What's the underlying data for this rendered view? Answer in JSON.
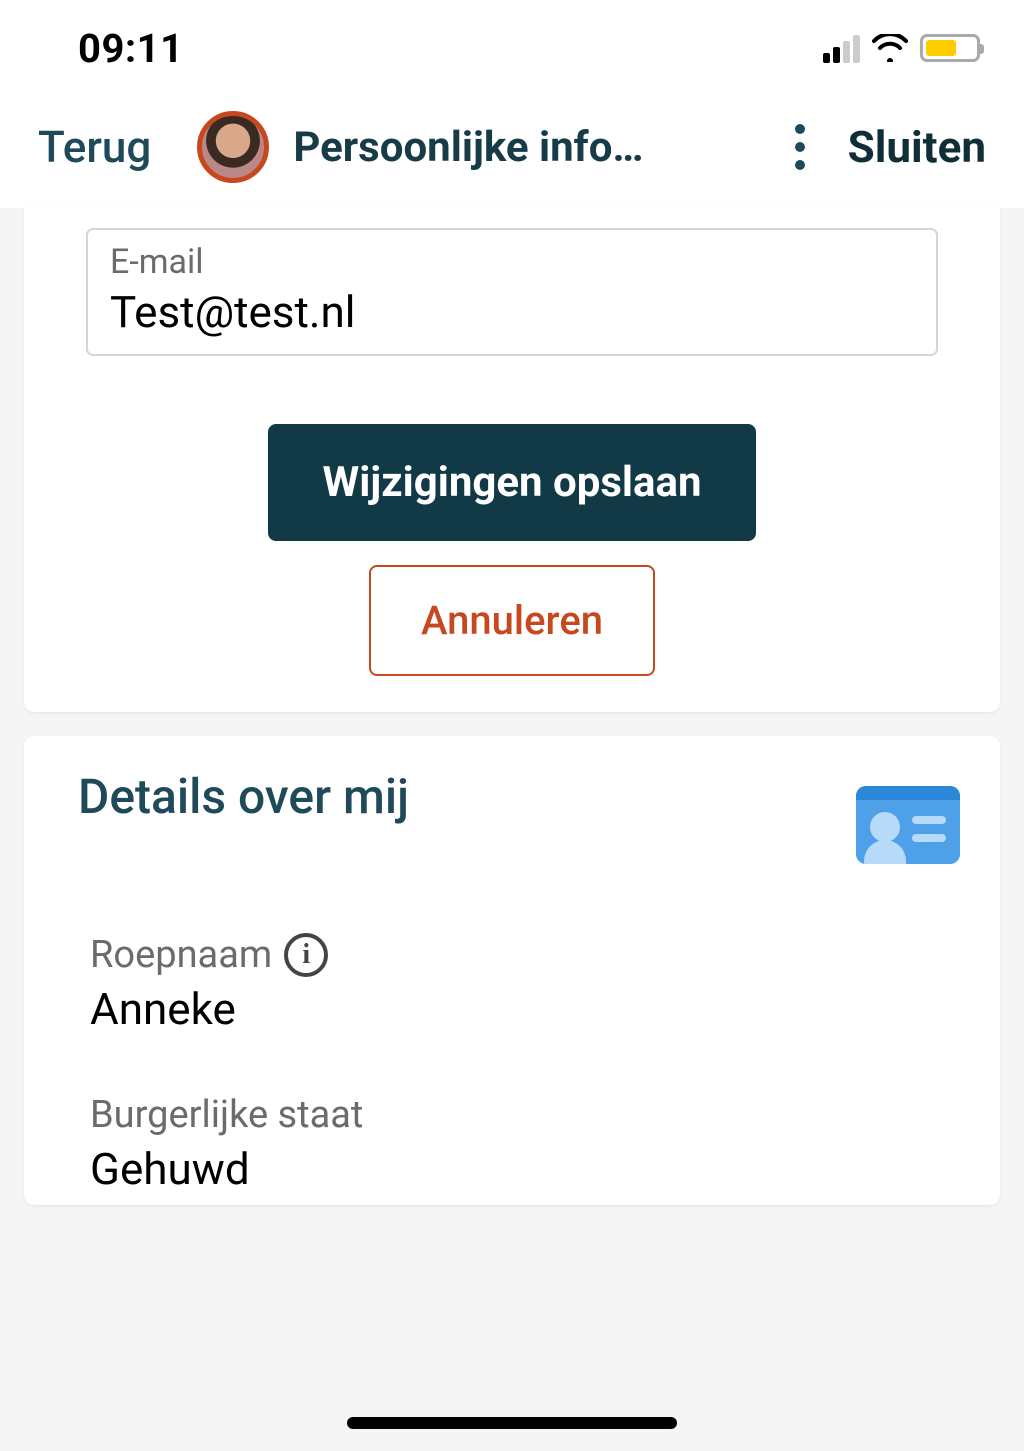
{
  "status": {
    "time": "09:11"
  },
  "header": {
    "back_label": "Terug",
    "title": "Persoonlijke infor...",
    "close_label": "Sluiten"
  },
  "form": {
    "email_label": "E-mail",
    "email_value": "Test@test.nl",
    "save_label": "Wijzigingen opslaan",
    "cancel_label": "Annuleren"
  },
  "details": {
    "section_title": "Details over mij",
    "fields": [
      {
        "label": "Roepnaam",
        "value": "Anneke",
        "has_info": true
      },
      {
        "label": "Burgerlijke staat",
        "value": "Gehuwd",
        "has_info": false
      }
    ]
  }
}
